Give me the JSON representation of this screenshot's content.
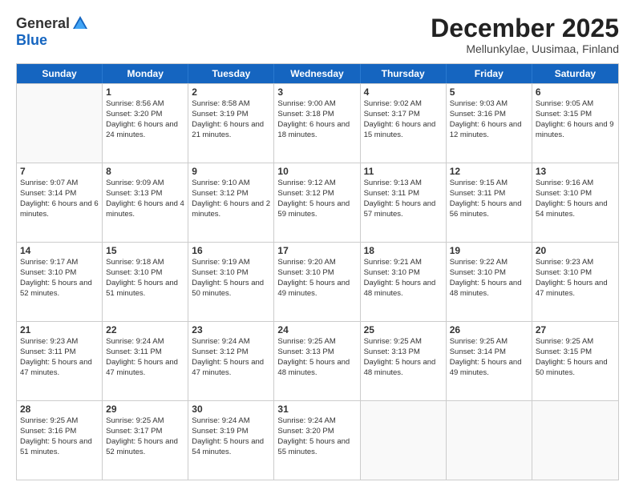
{
  "header": {
    "logo_general": "General",
    "logo_blue": "Blue",
    "month_title": "December 2025",
    "location": "Mellunkylae, Uusimaa, Finland"
  },
  "weekdays": [
    "Sunday",
    "Monday",
    "Tuesday",
    "Wednesday",
    "Thursday",
    "Friday",
    "Saturday"
  ],
  "weeks": [
    [
      {
        "day": "",
        "empty": true
      },
      {
        "day": "1",
        "sunrise": "Sunrise: 8:56 AM",
        "sunset": "Sunset: 3:20 PM",
        "daylight": "Daylight: 6 hours and 24 minutes."
      },
      {
        "day": "2",
        "sunrise": "Sunrise: 8:58 AM",
        "sunset": "Sunset: 3:19 PM",
        "daylight": "Daylight: 6 hours and 21 minutes."
      },
      {
        "day": "3",
        "sunrise": "Sunrise: 9:00 AM",
        "sunset": "Sunset: 3:18 PM",
        "daylight": "Daylight: 6 hours and 18 minutes."
      },
      {
        "day": "4",
        "sunrise": "Sunrise: 9:02 AM",
        "sunset": "Sunset: 3:17 PM",
        "daylight": "Daylight: 6 hours and 15 minutes."
      },
      {
        "day": "5",
        "sunrise": "Sunrise: 9:03 AM",
        "sunset": "Sunset: 3:16 PM",
        "daylight": "Daylight: 6 hours and 12 minutes."
      },
      {
        "day": "6",
        "sunrise": "Sunrise: 9:05 AM",
        "sunset": "Sunset: 3:15 PM",
        "daylight": "Daylight: 6 hours and 9 minutes."
      }
    ],
    [
      {
        "day": "7",
        "sunrise": "Sunrise: 9:07 AM",
        "sunset": "Sunset: 3:14 PM",
        "daylight": "Daylight: 6 hours and 6 minutes."
      },
      {
        "day": "8",
        "sunrise": "Sunrise: 9:09 AM",
        "sunset": "Sunset: 3:13 PM",
        "daylight": "Daylight: 6 hours and 4 minutes."
      },
      {
        "day": "9",
        "sunrise": "Sunrise: 9:10 AM",
        "sunset": "Sunset: 3:12 PM",
        "daylight": "Daylight: 6 hours and 2 minutes."
      },
      {
        "day": "10",
        "sunrise": "Sunrise: 9:12 AM",
        "sunset": "Sunset: 3:12 PM",
        "daylight": "Daylight: 5 hours and 59 minutes."
      },
      {
        "day": "11",
        "sunrise": "Sunrise: 9:13 AM",
        "sunset": "Sunset: 3:11 PM",
        "daylight": "Daylight: 5 hours and 57 minutes."
      },
      {
        "day": "12",
        "sunrise": "Sunrise: 9:15 AM",
        "sunset": "Sunset: 3:11 PM",
        "daylight": "Daylight: 5 hours and 56 minutes."
      },
      {
        "day": "13",
        "sunrise": "Sunrise: 9:16 AM",
        "sunset": "Sunset: 3:10 PM",
        "daylight": "Daylight: 5 hours and 54 minutes."
      }
    ],
    [
      {
        "day": "14",
        "sunrise": "Sunrise: 9:17 AM",
        "sunset": "Sunset: 3:10 PM",
        "daylight": "Daylight: 5 hours and 52 minutes."
      },
      {
        "day": "15",
        "sunrise": "Sunrise: 9:18 AM",
        "sunset": "Sunset: 3:10 PM",
        "daylight": "Daylight: 5 hours and 51 minutes."
      },
      {
        "day": "16",
        "sunrise": "Sunrise: 9:19 AM",
        "sunset": "Sunset: 3:10 PM",
        "daylight": "Daylight: 5 hours and 50 minutes."
      },
      {
        "day": "17",
        "sunrise": "Sunrise: 9:20 AM",
        "sunset": "Sunset: 3:10 PM",
        "daylight": "Daylight: 5 hours and 49 minutes."
      },
      {
        "day": "18",
        "sunrise": "Sunrise: 9:21 AM",
        "sunset": "Sunset: 3:10 PM",
        "daylight": "Daylight: 5 hours and 48 minutes."
      },
      {
        "day": "19",
        "sunrise": "Sunrise: 9:22 AM",
        "sunset": "Sunset: 3:10 PM",
        "daylight": "Daylight: 5 hours and 48 minutes."
      },
      {
        "day": "20",
        "sunrise": "Sunrise: 9:23 AM",
        "sunset": "Sunset: 3:10 PM",
        "daylight": "Daylight: 5 hours and 47 minutes."
      }
    ],
    [
      {
        "day": "21",
        "sunrise": "Sunrise: 9:23 AM",
        "sunset": "Sunset: 3:11 PM",
        "daylight": "Daylight: 5 hours and 47 minutes."
      },
      {
        "day": "22",
        "sunrise": "Sunrise: 9:24 AM",
        "sunset": "Sunset: 3:11 PM",
        "daylight": "Daylight: 5 hours and 47 minutes."
      },
      {
        "day": "23",
        "sunrise": "Sunrise: 9:24 AM",
        "sunset": "Sunset: 3:12 PM",
        "daylight": "Daylight: 5 hours and 47 minutes."
      },
      {
        "day": "24",
        "sunrise": "Sunrise: 9:25 AM",
        "sunset": "Sunset: 3:13 PM",
        "daylight": "Daylight: 5 hours and 48 minutes."
      },
      {
        "day": "25",
        "sunrise": "Sunrise: 9:25 AM",
        "sunset": "Sunset: 3:13 PM",
        "daylight": "Daylight: 5 hours and 48 minutes."
      },
      {
        "day": "26",
        "sunrise": "Sunrise: 9:25 AM",
        "sunset": "Sunset: 3:14 PM",
        "daylight": "Daylight: 5 hours and 49 minutes."
      },
      {
        "day": "27",
        "sunrise": "Sunrise: 9:25 AM",
        "sunset": "Sunset: 3:15 PM",
        "daylight": "Daylight: 5 hours and 50 minutes."
      }
    ],
    [
      {
        "day": "28",
        "sunrise": "Sunrise: 9:25 AM",
        "sunset": "Sunset: 3:16 PM",
        "daylight": "Daylight: 5 hours and 51 minutes."
      },
      {
        "day": "29",
        "sunrise": "Sunrise: 9:25 AM",
        "sunset": "Sunset: 3:17 PM",
        "daylight": "Daylight: 5 hours and 52 minutes."
      },
      {
        "day": "30",
        "sunrise": "Sunrise: 9:24 AM",
        "sunset": "Sunset: 3:19 PM",
        "daylight": "Daylight: 5 hours and 54 minutes."
      },
      {
        "day": "31",
        "sunrise": "Sunrise: 9:24 AM",
        "sunset": "Sunset: 3:20 PM",
        "daylight": "Daylight: 5 hours and 55 minutes."
      },
      {
        "day": "",
        "empty": true
      },
      {
        "day": "",
        "empty": true
      },
      {
        "day": "",
        "empty": true
      }
    ]
  ]
}
